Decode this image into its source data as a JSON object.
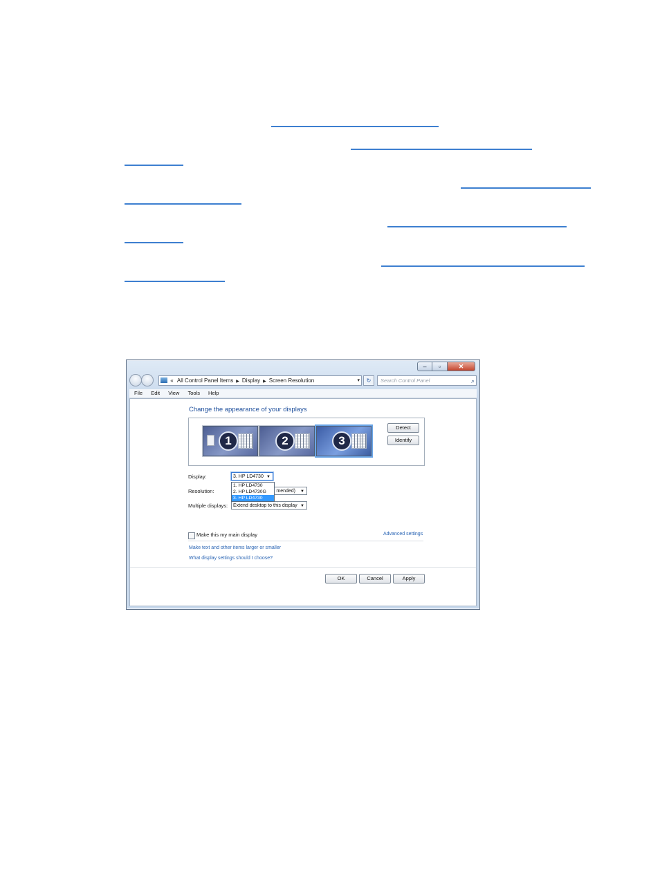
{
  "window": {
    "caption_buttons": {
      "minimize": "–",
      "maximize": "▫",
      "close": "✕"
    },
    "address": {
      "chevrons": "«",
      "crumbs": [
        "All Control Panel Items",
        "Display",
        "Screen Resolution"
      ],
      "dropdown_glyph": "▾"
    },
    "refresh_glyph": "↻",
    "search": {
      "placeholder": "Search Control Panel",
      "icon": "search-icon"
    },
    "menu": [
      "File",
      "Edit",
      "View",
      "Tools",
      "Help"
    ],
    "title": "Change the appearance of your displays",
    "monitors": [
      {
        "number": "1",
        "active": false
      },
      {
        "number": "2",
        "active": false
      },
      {
        "number": "3",
        "active": true
      }
    ],
    "detect_label": "Detect",
    "identify_label": "Identify",
    "display_label": "Display:",
    "display_value": "3. HP LD4730",
    "display_options": [
      "1. HP LD4730",
      "2. HP LD4730G",
      "3. HP LD4730"
    ],
    "resolution_label": "Resolution:",
    "resolution_value": "mended)",
    "multiple_label": "Multiple displays:",
    "multiple_value": "Extend desktop to this display",
    "main_display_label": "Make this my main display",
    "advanced_link": "Advanced settings",
    "link_text_larger": "Make text and other items larger or smaller",
    "link_settings_help": "What display settings should I choose?",
    "ok_label": "OK",
    "cancel_label": "Cancel",
    "apply_label": "Apply"
  },
  "colors": {
    "link": "#2964b4",
    "title": "#1e4f9c",
    "selection": "#3399ff"
  }
}
